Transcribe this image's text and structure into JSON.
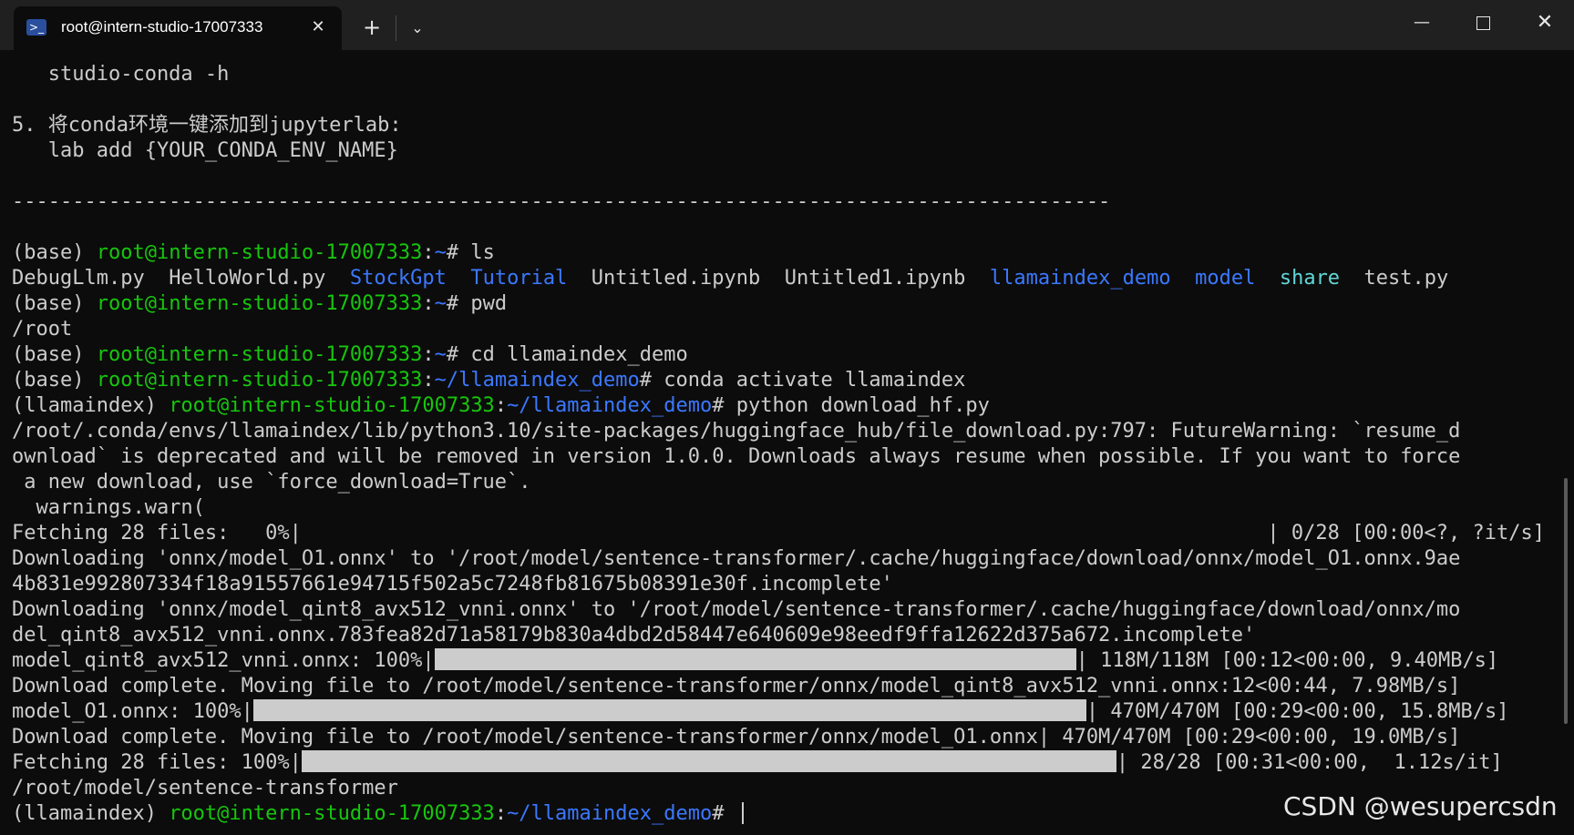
{
  "window": {
    "tab_title": "root@intern-studio-17007333",
    "tab_icon": "powershell-icon",
    "new_tab_label": "+",
    "dropdown_label": "⌄",
    "minimize_label": "—",
    "close_label": "✕",
    "tab_close_label": "✕"
  },
  "colors": {
    "background": "#0c0c0c",
    "green": "#16c60c",
    "blue": "#3b78ff",
    "cyan": "#61d6d6",
    "text": "#cccccc"
  },
  "terminal": {
    "l1": "   studio-conda -h",
    "l3": "5. 将conda环境一键添加到jupyterlab:",
    "l4": "   lab add {YOUR_CONDA_ENV_NAME}",
    "separator": "-------------------------------------------------------------------------------------------",
    "base": "(base) ",
    "llenv": "(llamaindex) ",
    "host": "root@intern-studio-17007333",
    "colon": ":",
    "tilde": "~",
    "demo_path": "~/llamaindex_demo",
    "hash": "# ",
    "cmd_ls": "ls",
    "ls_items": {
      "f1": "DebugLlm.py  ",
      "f2": "HelloWorld.py  ",
      "d1": "StockGpt",
      "sp": "  ",
      "d2": "Tutorial",
      "f3": "  Untitled.ipynb  Untitled1.ipynb  ",
      "d3": "llamaindex_demo",
      "d4": "model",
      "d5": "share",
      "f4": "  test.py"
    },
    "cmd_pwd": "pwd",
    "out_pwd": "/root",
    "cmd_cd": "cd llamaindex_demo",
    "cmd_activate": "conda activate llamaindex",
    "cmd_python": "python download_hf.py",
    "warn1": "/root/.conda/envs/llamaindex/lib/python3.10/site-packages/huggingface_hub/file_download.py:797: FutureWarning: `resume_d",
    "warn2": "ownload` is deprecated and will be removed in version 1.0.0. Downloads always resume when possible. If you want to force",
    "warn3": " a new download, use `force_download=True`.",
    "warn4": "  warnings.warn(",
    "fetch0_left": "Fetching 28 files:   0%|",
    "fetch0_right": "| 0/28 [00:00<?, ?it/s]",
    "dl1a": "Downloading 'onnx/model_O1.onnx' to '/root/model/sentence-transformer/.cache/huggingface/download/onnx/model_O1.onnx.9ae",
    "dl1b": "4b831e992807334f18a91557661e94715f502a5c7248fb81675b08391e30f.incomplete'",
    "dl2a": "Downloading 'onnx/model_qint8_avx512_vnni.onnx' to '/root/model/sentence-transformer/.cache/huggingface/download/onnx/mo",
    "dl2b": "del_qint8_avx512_vnni.onnx.783fea82d71a58179b830a4dbd2d58447e640609e98eedf9ffa12622d375a672.incomplete'",
    "p1_left": "model_qint8_avx512_vnni.onnx: 100%|",
    "p1_right": "| 118M/118M [00:12<00:00, 9.40MB/s]",
    "done1": "Download complete. Moving file to /root/model/sentence-transformer/onnx/model_qint8_avx512_vnni.onnx:12<00:44, 7.98MB/s]",
    "p2_left": "model_O1.onnx: 100%|",
    "p2_right": "| 470M/470M [00:29<00:00, 15.8MB/s]",
    "done2": "Download complete. Moving file to /root/model/sentence-transformer/onnx/model_O1.onnx| 470M/470M [00:29<00:00, 19.0MB/s]",
    "p3_left": "Fetching 28 files: 100%|",
    "p3_right": "| 28/28 [00:31<00:00,  1.12s/it]",
    "out_path": "/root/model/sentence-transformer"
  },
  "progress": {
    "fetch_start": 0.0,
    "model_qint8": 1.0,
    "model_O1": 1.0,
    "fetch_end": 1.0
  },
  "watermark": "CSDN @wesupercsdn"
}
